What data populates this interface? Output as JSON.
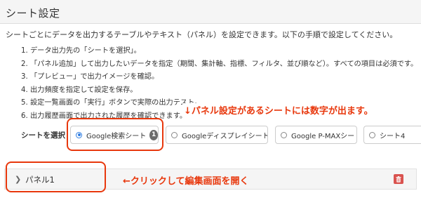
{
  "header": {
    "title": "シート設定"
  },
  "description": "シートごとにデータを出力するテーブルやテキスト（パネル）を設定できます。以下の手順で設定してください。",
  "steps": [
    "1. データ出力先の「シートを選択」。",
    "2. 「パネル追加」して出力したいデータを指定（期間、集計軸、指標、フィルタ、並び順など）。すべての項目は必須です。",
    "3. 「プレビュー」で出力イメージを確認。",
    "4. 出力頻度を指定して設定を保存。",
    "5. 設定一覧画面の「実行」ボタンで実際の出力テスト。",
    "6. 出力履歴画面で出力された履歴を確認できます。"
  ],
  "annotations": {
    "panel_count_note": "↓パネル設定があるシートには数字が出ます。",
    "panel_click_note": "←クリックして編集画面を開く",
    "accent_color": "#e8380d"
  },
  "sheet_selector": {
    "label": "シートを選択",
    "options": [
      {
        "label": "Google検索シート",
        "selected": true,
        "badge": "1"
      },
      {
        "label": "Googleディスプレイシート",
        "selected": false
      },
      {
        "label": "Google P-MAXシート",
        "selected": false
      },
      {
        "label": "シート4",
        "selected": false
      }
    ]
  },
  "panels": [
    {
      "title": "パネル1",
      "toggle_icon": "chevron-right-icon",
      "delete_icon": "trash-icon"
    }
  ]
}
